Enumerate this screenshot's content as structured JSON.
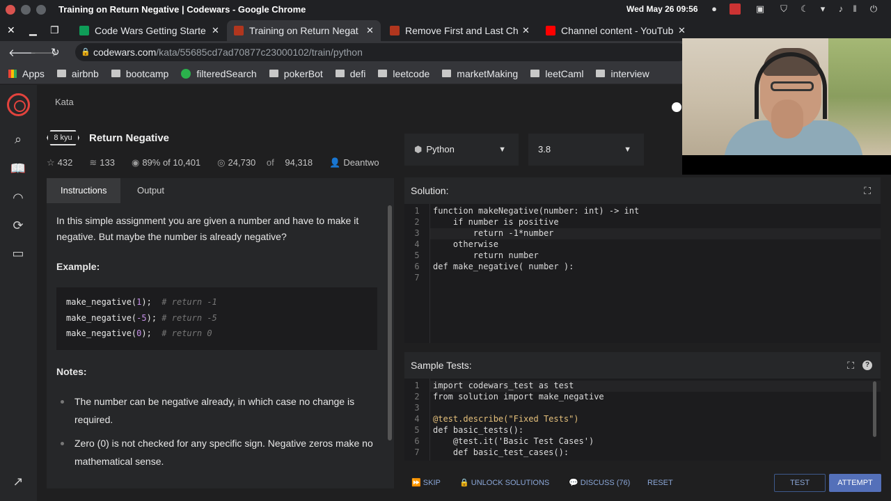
{
  "window": {
    "title": "Training on Return Negative | Codewars - Google Chrome",
    "clock": "Wed May 26  09:56"
  },
  "tabs": [
    {
      "label": "Code Wars Getting Starte",
      "color": "#0f9d58"
    },
    {
      "label": "Training on Return Negat",
      "color": "#b1361e"
    },
    {
      "label": "Remove First and Last Ch",
      "color": "#b1361e"
    },
    {
      "label": "Channel content - YouTub",
      "color": "#ff0000"
    }
  ],
  "address": {
    "domain": "codewars.com",
    "path": "/kata/55685cd7ad70877c23000102/train/python"
  },
  "bookmarks": [
    "Apps",
    "airbnb",
    "bootcamp",
    "filteredSearch",
    "pokerBot",
    "defi",
    "leetcode",
    "marketMaking",
    "leetCaml",
    "interview"
  ],
  "kata": {
    "crumb": "Kata",
    "rank": "8 kyu",
    "title": "Return Negative",
    "stars": "432",
    "collections": "133",
    "satisfaction": "89% of 10,401",
    "completed_a": "24,730",
    "completed_of": " of ",
    "completed_b": "94,318",
    "author": "Deantwo"
  },
  "instructions": {
    "tab_instructions": "Instructions",
    "tab_output": "Output",
    "intro": "In this simple assignment you are given a number and have to make it negative. But maybe the number is already negative?",
    "example_heading": "Example:",
    "examples": [
      {
        "call": "make_negative(",
        "arg": "1",
        "close": ");  ",
        "comment": "# return -1"
      },
      {
        "call": "make_negative(",
        "arg": "-5",
        "close": "); ",
        "comment": "# return -5"
      },
      {
        "call": "make_negative(",
        "arg": "0",
        "close": ");  ",
        "comment": "# return 0"
      }
    ],
    "notes_heading": "Notes:",
    "notes": [
      "The number can be negative already, in which case no change is required.",
      "Zero (0) is not checked for any specific sign. Negative zeros make no mathematical sense."
    ]
  },
  "language": {
    "name": "Python",
    "version": "3.8"
  },
  "solution": {
    "heading": "Solution:",
    "lines": [
      "function makeNegative(number: int) -> int",
      "    if number is positive",
      "        return -1*number",
      "    otherwise",
      "        return number",
      "def make_negative( number ):",
      ""
    ]
  },
  "sample_tests": {
    "heading": "Sample Tests:",
    "lines": [
      "import codewars_test as test",
      "from solution import make_negative",
      "",
      "@test.describe(\"Fixed Tests\")",
      "def basic_tests():",
      "    @test.it('Basic Test Cases')",
      "    def basic_test_cases():"
    ]
  },
  "actions": {
    "skip": "SKIP",
    "unlock": "UNLOCK SOLUTIONS",
    "discuss": "DISCUSS (76)",
    "reset": "RESET",
    "test": "TEST",
    "attempt": "ATTEMPT"
  }
}
